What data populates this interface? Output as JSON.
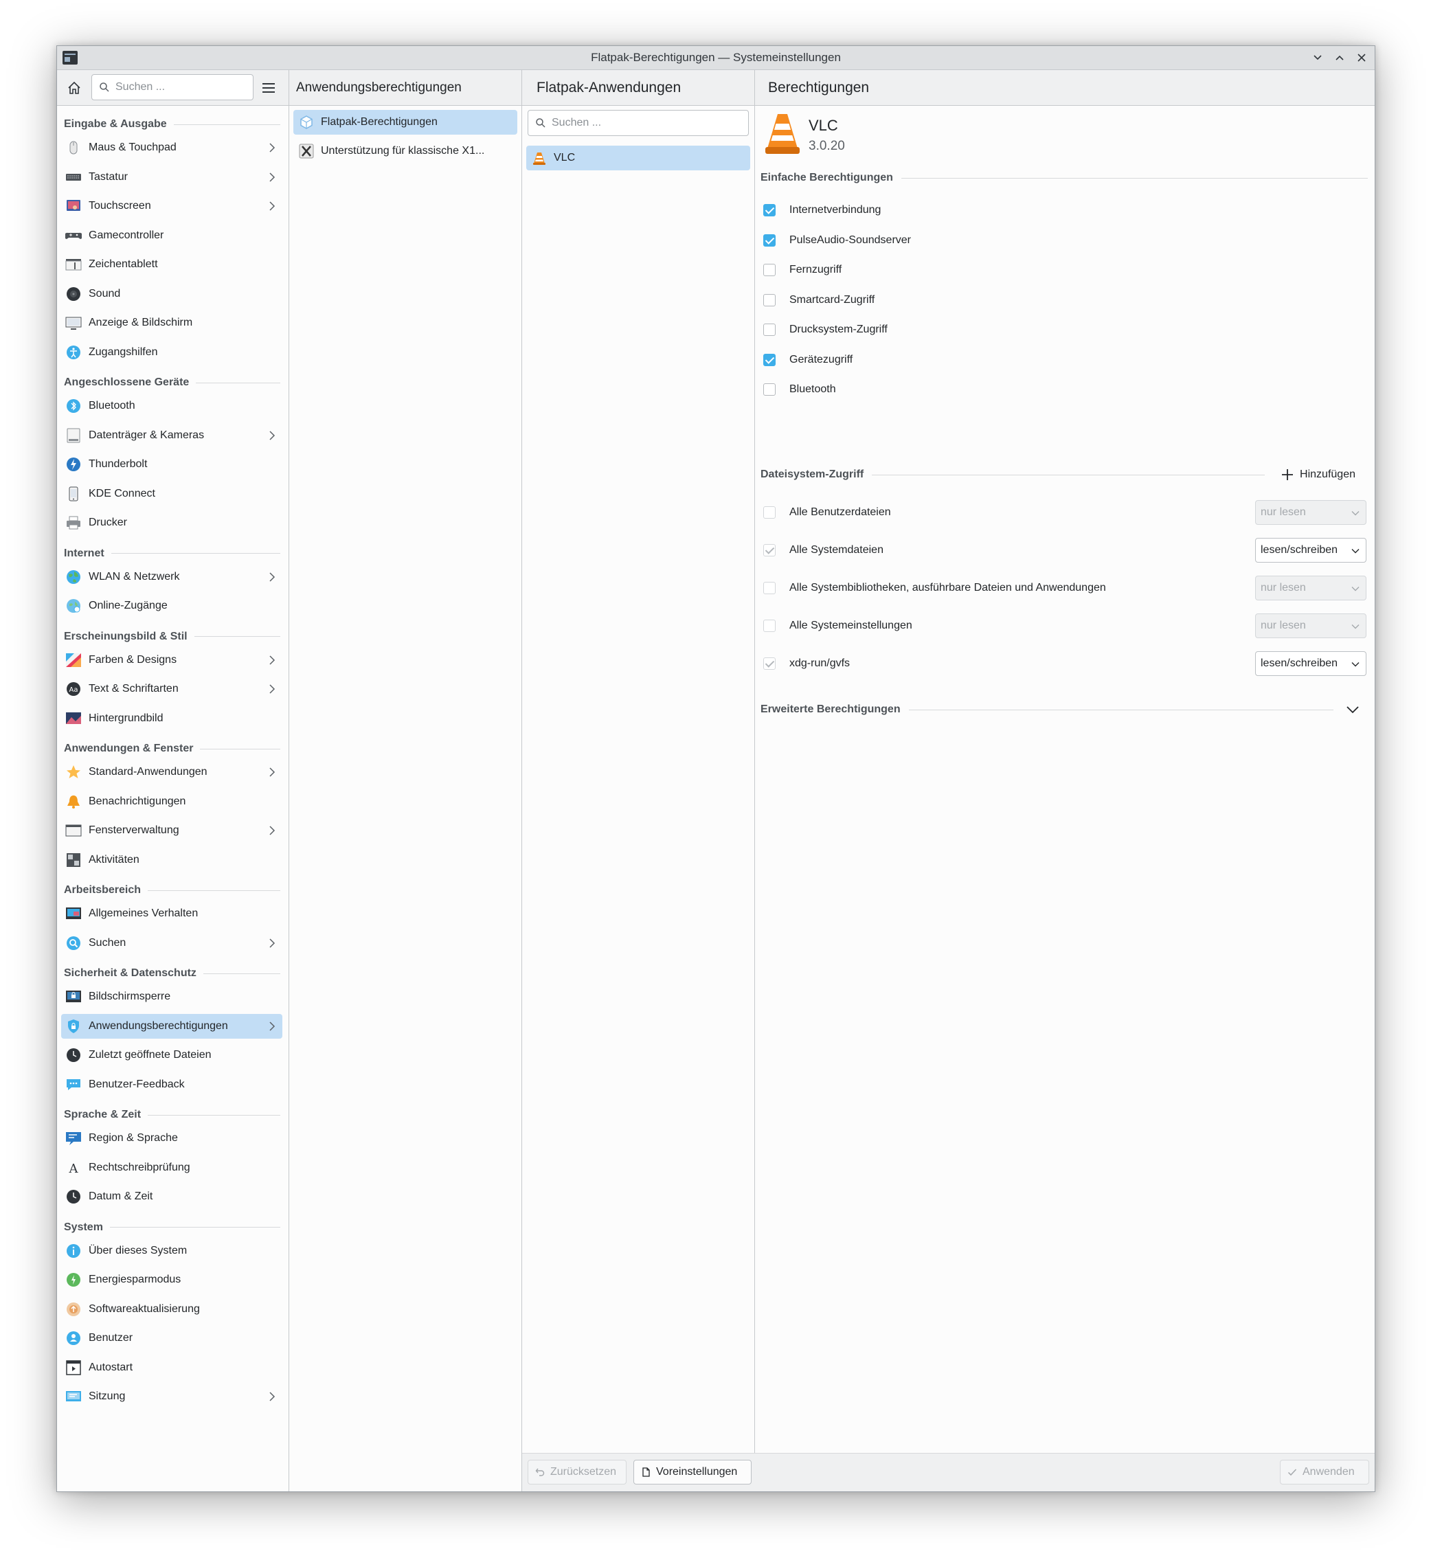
{
  "window": {
    "title": "Flatpak-Berechtigungen — Systemeinstellungen"
  },
  "sidebar": {
    "search_placeholder": "Suchen ...",
    "sections": [
      {
        "title": "Eingabe & Ausgabe",
        "items": [
          {
            "label": "Maus & Touchpad",
            "icon": "mouse-icon",
            "chevron": true
          },
          {
            "label": "Tastatur",
            "icon": "keyboard-icon",
            "chevron": true
          },
          {
            "label": "Touchscreen",
            "icon": "touchscreen-icon",
            "chevron": true
          },
          {
            "label": "Gamecontroller",
            "icon": "gamepad-icon",
            "chevron": false
          },
          {
            "label": "Zeichentablett",
            "icon": "tablet-icon",
            "chevron": false
          },
          {
            "label": "Sound",
            "icon": "sound-icon",
            "chevron": false
          },
          {
            "label": "Anzeige & Bildschirm",
            "icon": "display-icon",
            "chevron": false
          },
          {
            "label": "Zugangshilfen",
            "icon": "accessibility-icon",
            "chevron": false
          }
        ]
      },
      {
        "title": "Angeschlossene Geräte",
        "items": [
          {
            "label": "Bluetooth",
            "icon": "bluetooth-icon",
            "chevron": false
          },
          {
            "label": "Datenträger & Kameras",
            "icon": "drive-icon",
            "chevron": true
          },
          {
            "label": "Thunderbolt",
            "icon": "thunderbolt-icon",
            "chevron": false
          },
          {
            "label": "KDE Connect",
            "icon": "phone-icon",
            "chevron": false
          },
          {
            "label": "Drucker",
            "icon": "printer-icon",
            "chevron": false
          }
        ]
      },
      {
        "title": "Internet",
        "items": [
          {
            "label": "WLAN & Netzwerk",
            "icon": "globe-icon",
            "chevron": true
          },
          {
            "label": "Online-Zugänge",
            "icon": "online-accounts-icon",
            "chevron": false
          }
        ]
      },
      {
        "title": "Erscheinungsbild & Stil",
        "items": [
          {
            "label": "Farben & Designs",
            "icon": "colors-icon",
            "chevron": true
          },
          {
            "label": "Text & Schriftarten",
            "icon": "font-icon",
            "chevron": true
          },
          {
            "label": "Hintergrundbild",
            "icon": "wallpaper-icon",
            "chevron": false
          }
        ]
      },
      {
        "title": "Anwendungen & Fenster",
        "items": [
          {
            "label": "Standard-Anwendungen",
            "icon": "star-icon",
            "chevron": true
          },
          {
            "label": "Benachrichtigungen",
            "icon": "bell-icon",
            "chevron": false
          },
          {
            "label": "Fensterverwaltung",
            "icon": "window-icon",
            "chevron": true
          },
          {
            "label": "Aktivitäten",
            "icon": "activities-icon",
            "chevron": false
          }
        ]
      },
      {
        "title": "Arbeitsbereich",
        "items": [
          {
            "label": "Allgemeines Verhalten",
            "icon": "desktop-icon",
            "chevron": false
          },
          {
            "label": "Suchen",
            "icon": "search-icon",
            "chevron": true
          }
        ]
      },
      {
        "title": "Sicherheit & Datenschutz",
        "items": [
          {
            "label": "Bildschirmsperre",
            "icon": "lock-screen-icon",
            "chevron": false
          },
          {
            "label": "Anwendungsberechtigungen",
            "icon": "shield-icon",
            "chevron": true,
            "selected": true
          },
          {
            "label": "Zuletzt geöffnete Dateien",
            "icon": "clock-icon",
            "chevron": false
          },
          {
            "label": "Benutzer-Feedback",
            "icon": "feedback-icon",
            "chevron": false
          }
        ]
      },
      {
        "title": "Sprache & Zeit",
        "items": [
          {
            "label": "Region & Sprache",
            "icon": "region-icon",
            "chevron": false
          },
          {
            "label": "Rechtschreibprüfung",
            "icon": "spellcheck-icon",
            "chevron": false
          },
          {
            "label": "Datum & Zeit",
            "icon": "clock-icon",
            "chevron": false
          }
        ]
      },
      {
        "title": "System",
        "items": [
          {
            "label": "Über dieses System",
            "icon": "info-icon",
            "chevron": false
          },
          {
            "label": "Energiesparmodus",
            "icon": "power-icon",
            "chevron": false
          },
          {
            "label": "Softwareaktualisierung",
            "icon": "update-icon",
            "chevron": false
          },
          {
            "label": "Benutzer",
            "icon": "user-icon",
            "chevron": false
          },
          {
            "label": "Autostart",
            "icon": "autostart-icon",
            "chevron": false
          },
          {
            "label": "Sitzung",
            "icon": "session-icon",
            "chevron": true
          }
        ]
      }
    ]
  },
  "col2": {
    "title": "Anwendungsberechtigungen",
    "items": [
      {
        "label": "Flatpak-Berechtigungen",
        "icon": "flatpak-icon",
        "selected": true
      },
      {
        "label": "Unterstützung für klassische X1...",
        "icon": "x11-icon",
        "selected": false
      }
    ]
  },
  "col3": {
    "title": "Flatpak-Anwendungen",
    "search_placeholder": "Suchen ...",
    "items": [
      {
        "label": "VLC",
        "icon": "vlc-icon",
        "selected": true
      }
    ]
  },
  "col4": {
    "title": "Berechtigungen",
    "app": {
      "name": "VLC",
      "version": "3.0.20",
      "icon": "vlc-icon"
    },
    "basic_title": "Einfache Berechtigungen",
    "basic": [
      {
        "label": "Internetverbindung",
        "checked": true
      },
      {
        "label": "PulseAudio-Soundserver",
        "checked": true
      },
      {
        "label": "Fernzugriff",
        "checked": false
      },
      {
        "label": "Smartcard-Zugriff",
        "checked": false
      },
      {
        "label": "Drucksystem-Zugriff",
        "checked": false
      },
      {
        "label": "Gerätezugriff",
        "checked": true
      },
      {
        "label": "Bluetooth",
        "checked": false
      }
    ],
    "fs_title": "Dateisystem-Zugriff",
    "add_label": "Hinzufügen",
    "filesystem": [
      {
        "label": "Alle Benutzerdateien",
        "checked": false,
        "mode": "nur lesen",
        "enabled": false
      },
      {
        "label": "Alle Systemdateien",
        "checked": true,
        "mode": "lesen/schreiben",
        "enabled": true
      },
      {
        "label": "Alle Systembibliotheken, ausführbare Dateien und Anwendungen",
        "checked": false,
        "mode": "nur lesen",
        "enabled": false
      },
      {
        "label": "Alle Systemeinstellungen",
        "checked": false,
        "mode": "nur lesen",
        "enabled": false
      },
      {
        "label": "xdg-run/gvfs",
        "checked": true,
        "mode": "lesen/schreiben",
        "enabled": true
      }
    ],
    "advanced_title": "Erweiterte Berechtigungen"
  },
  "footer": {
    "reset_label": "Zurücksetzen",
    "defaults_label": "Voreinstellungen",
    "apply_label": "Anwenden"
  },
  "colors": {
    "accent": "#3daee9",
    "selection": "#c2ddf5"
  }
}
